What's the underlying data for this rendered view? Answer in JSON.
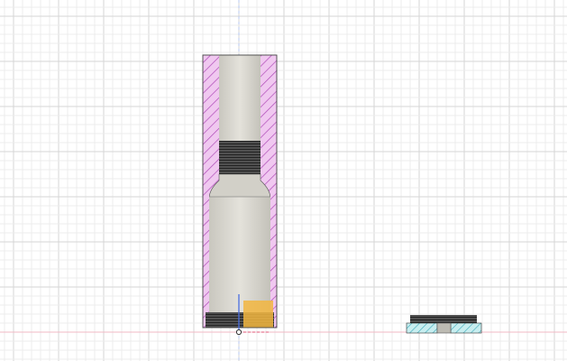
{
  "viewport": {
    "background": "#ffffff",
    "grid_minor_color": "#ececec",
    "grid_major_color": "#d6d6d6",
    "axis_x_color": "#f2b8c6",
    "axis_y_color": "#b8c8f2"
  },
  "section_view": {
    "hatch_primary_color": "#b04ab8",
    "hatch_primary_fill": "#f0c8f0",
    "hatch_secondary_color": "#3aa8b8",
    "hatch_secondary_fill": "#c8eef0",
    "body_color": "#dcdad3",
    "thread_color": "#3a3a3a",
    "highlight_color": "#f2b640"
  },
  "origin_marker": {
    "icon": "origin-triad-icon",
    "color": "#4a6ee0"
  }
}
